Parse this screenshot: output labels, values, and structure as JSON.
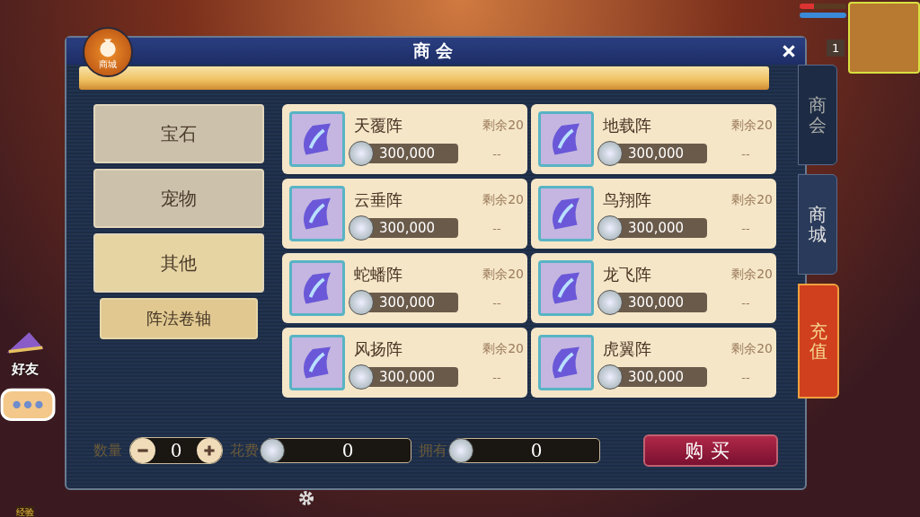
{
  "hud": {
    "player_level": "1",
    "friends_label": "好友",
    "exp_label": "经验"
  },
  "shop_badge": {
    "label": "商城"
  },
  "window": {
    "title": "商会"
  },
  "categories": [
    {
      "label": "宝石",
      "selected": false
    },
    {
      "label": "宠物",
      "selected": false
    },
    {
      "label": "其他",
      "selected": true,
      "children": [
        {
          "label": "阵法卷轴",
          "selected": true
        }
      ]
    }
  ],
  "items": [
    {
      "name": "天覆阵",
      "remaining": "剩余20",
      "price": "300,000",
      "owned": "--"
    },
    {
      "name": "地载阵",
      "remaining": "剩余20",
      "price": "300,000",
      "owned": "--"
    },
    {
      "name": "云垂阵",
      "remaining": "剩余20",
      "price": "300,000",
      "owned": "--"
    },
    {
      "name": "鸟翔阵",
      "remaining": "剩余20",
      "price": "300,000",
      "owned": "--"
    },
    {
      "name": "蛇蟠阵",
      "remaining": "剩余20",
      "price": "300,000",
      "owned": "--"
    },
    {
      "name": "龙飞阵",
      "remaining": "剩余20",
      "price": "300,000",
      "owned": "--"
    },
    {
      "name": "风扬阵",
      "remaining": "剩余20",
      "price": "300,000",
      "owned": "--"
    },
    {
      "name": "虎翼阵",
      "remaining": "剩余20",
      "price": "300,000",
      "owned": "--"
    }
  ],
  "footer": {
    "quantity_label": "数量",
    "quantity": "0",
    "cost_label": "花费",
    "cost": "0",
    "owned_label": "拥有",
    "owned": "0",
    "buy_button": "购买"
  },
  "side_tabs": [
    {
      "label": "商会",
      "kind": "normal",
      "selected": true
    },
    {
      "label": "商城",
      "kind": "normal",
      "selected": false
    },
    {
      "label": "充值",
      "kind": "recharge",
      "selected": false
    }
  ]
}
